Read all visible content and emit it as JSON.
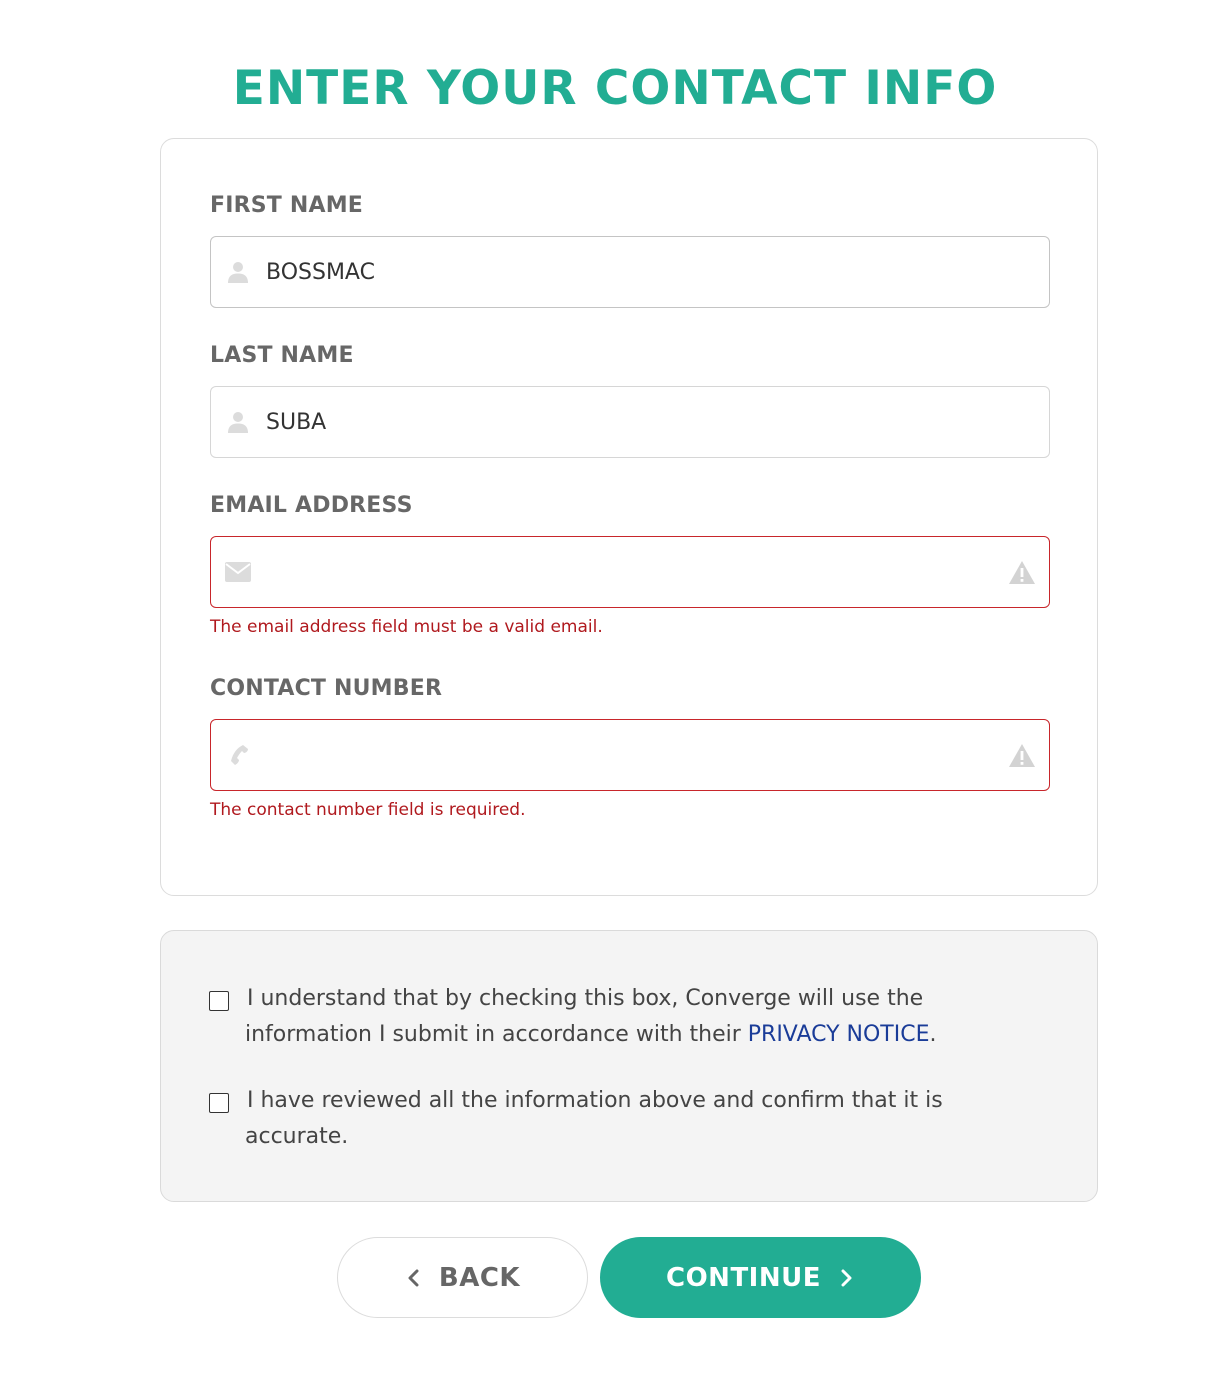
{
  "page": {
    "title": "ENTER YOUR CONTACT INFO"
  },
  "form": {
    "first_name": {
      "label": "FIRST NAME",
      "value": "BOSSMAC",
      "icon": "user-icon"
    },
    "last_name": {
      "label": "LAST NAME",
      "value": "SUBA",
      "icon": "user-icon"
    },
    "email": {
      "label": "EMAIL ADDRESS",
      "value": "",
      "icon": "envelope-icon",
      "error": "The email address field must be a valid email."
    },
    "contact_number": {
      "label": "CONTACT NUMBER",
      "value": "",
      "icon": "phone-icon",
      "error": "The contact number field is required."
    }
  },
  "consent": {
    "privacy": {
      "text_before": "I understand that by checking this box, Converge will use the information I submit in accordance with their ",
      "link_label": "PRIVACY NOTICE",
      "text_after": ".",
      "checked": false
    },
    "accuracy": {
      "text": "I have reviewed all the information above and confirm that it is accurate.",
      "checked": false
    }
  },
  "buttons": {
    "back_label": "BACK",
    "continue_label": "CONTINUE"
  },
  "colors": {
    "accent": "#22ad93",
    "error": "#c8262b",
    "link": "#1a3c98",
    "label": "#676767"
  }
}
